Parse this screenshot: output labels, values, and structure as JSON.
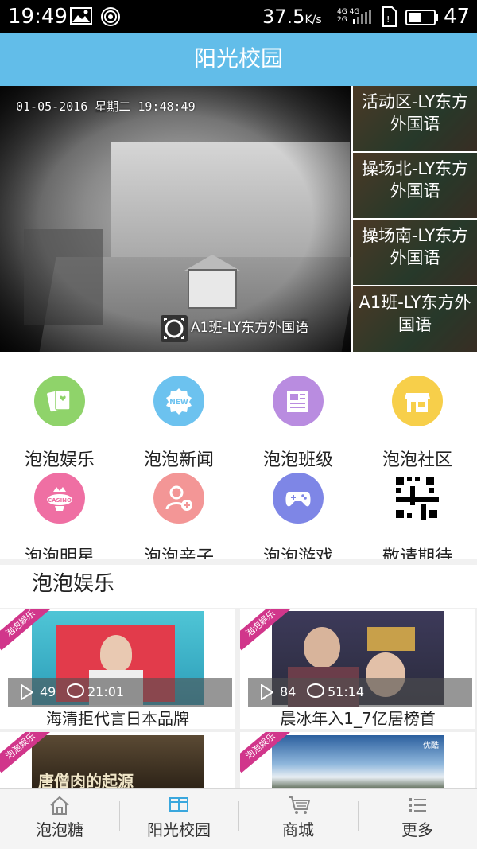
{
  "status_bar": {
    "time": "19:49",
    "network_speed": "37.5",
    "network_speed_unit": "K/s",
    "signal_labels": [
      "4G",
      "4G",
      "2G"
    ],
    "battery": "47"
  },
  "header": {
    "title": "阳光校园"
  },
  "video": {
    "timestamp": "01-05-2016  星期二  19:48:49",
    "caption": "A1班-LY东方外国语"
  },
  "cameras": [
    {
      "label": "活动区-LY东方外国语"
    },
    {
      "label": "操场北-LY东方外国语"
    },
    {
      "label": "操场南-LY东方外国语"
    },
    {
      "label": "A1班-LY东方外国语"
    }
  ],
  "grid": [
    {
      "label": "泡泡娱乐",
      "icon": "cards-icon",
      "color": "#8fd36a"
    },
    {
      "label": "泡泡新闻",
      "icon": "new-badge-icon",
      "color": "#6cc2ef",
      "badge_text": "NEW"
    },
    {
      "label": "泡泡班级",
      "icon": "newspaper-icon",
      "color": "#b98ce0"
    },
    {
      "label": "泡泡社区",
      "icon": "storefront-icon",
      "color": "#f7cf4a"
    },
    {
      "label": "泡泡明星",
      "icon": "casino-chip-icon",
      "color": "#ef6fa3",
      "badge_text": "CASINO"
    },
    {
      "label": "泡泡亲子",
      "icon": "parent-child-icon",
      "color": "#f39696"
    },
    {
      "label": "泡泡游戏",
      "icon": "gamepad-icon",
      "color": "#7e86e6"
    },
    {
      "label": "敬请期待",
      "icon": "qr-code-icon",
      "color": "#000000"
    }
  ],
  "section": {
    "title": "泡泡娱乐"
  },
  "cards": [
    {
      "ribbon": "泡泡娱乐",
      "views": "49",
      "duration": "21:01",
      "title": "海清拒代言日本品牌"
    },
    {
      "ribbon": "泡泡娱乐",
      "views": "84",
      "duration": "51:14",
      "title": "晨冰年入1_7亿居榜首"
    },
    {
      "ribbon": "泡泡娱乐",
      "thumb_text": "唐僧肉的起源"
    },
    {
      "ribbon": "泡泡娱乐",
      "thumb_text": "优酷"
    }
  ],
  "bottom_nav": [
    {
      "label": "泡泡糖",
      "icon": "home-icon"
    },
    {
      "label": "阳光校园",
      "icon": "campus-icon",
      "active": true
    },
    {
      "label": "商城",
      "icon": "cart-icon"
    },
    {
      "label": "更多",
      "icon": "more-list-icon"
    }
  ]
}
